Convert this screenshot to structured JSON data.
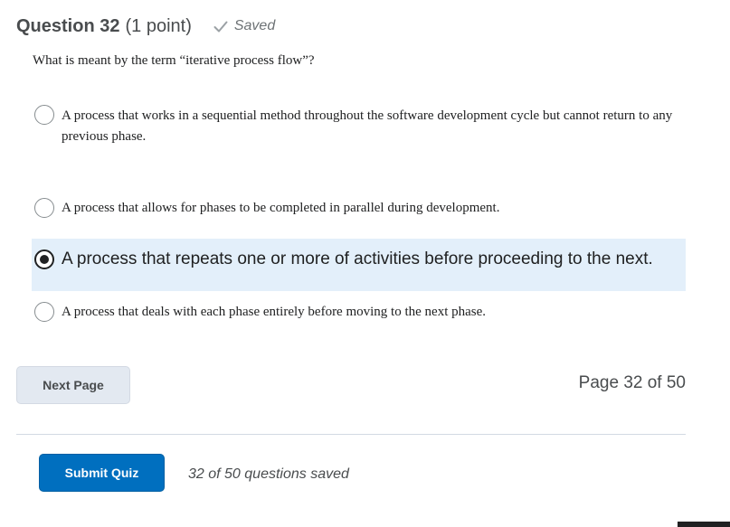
{
  "question": {
    "title": "Question 32",
    "points": "(1 point)",
    "saved_status": "Saved",
    "text": "What is meant by the term “iterative process flow”?"
  },
  "options": [
    {
      "label": "A process that works in a sequential method throughout the software development cycle but cannot return to any previous phase.",
      "selected": false
    },
    {
      "label": "A process that allows for phases to be completed in parallel during development.",
      "selected": false
    },
    {
      "label": "A process that repeats one or more of activities before proceeding to the next.",
      "selected": true
    },
    {
      "label": "A process that deals with each phase entirely before moving to the next phase.",
      "selected": false
    }
  ],
  "navigation": {
    "next_label": "Next Page",
    "page_indicator": "Page 32 of 50"
  },
  "footer": {
    "submit_label": "Submit Quiz",
    "saved_count": "32 of 50 questions saved"
  },
  "icons": {
    "saved": "checkmark-icon",
    "radio_selected": "radio-selected-icon",
    "radio_unselected": "radio-unselected-icon"
  },
  "colors": {
    "selected_option_bg": "#e3effa",
    "submit_button": "#006fbf",
    "next_button": "#e3e9f1",
    "saved_check": "#9ba1a5"
  }
}
